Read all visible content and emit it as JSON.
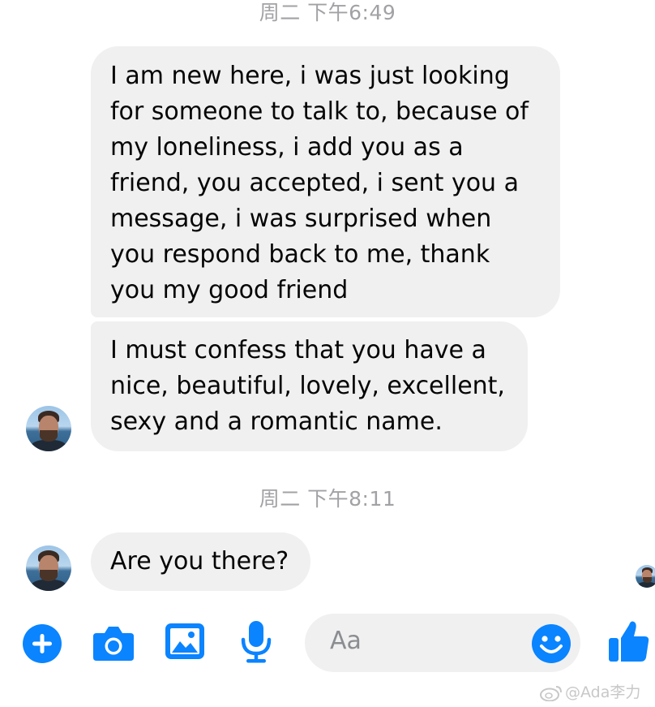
{
  "conversation": {
    "timestamps": [
      "周二 下午6:49",
      "周二 下午8:11"
    ],
    "messages": [
      "I am new here, i was just looking\nfor someone to talk to, because of\nmy loneliness, i add you as a\nfriend, you accepted, i sent you a\nmessage, i was surprised when\nyou respond back to me, thank\nyou my good friend",
      "I must confess that you have a\nnice, beautiful, lovely, excellent,\nsexy and a romantic name.",
      "Are you there?"
    ]
  },
  "composer": {
    "placeholder": "Aa",
    "icons": [
      "plus-icon",
      "camera-icon",
      "image-icon",
      "mic-icon",
      "emoji-icon",
      "like-icon"
    ],
    "accent_color": "#0a84ff"
  },
  "watermark": {
    "text": "@Ada李力"
  }
}
